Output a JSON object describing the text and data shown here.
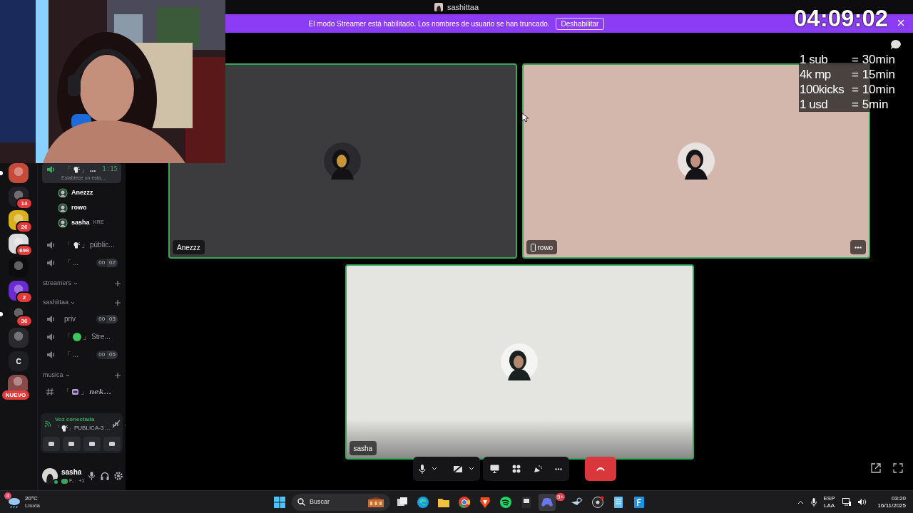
{
  "title_bar": {
    "title": "sashittaa"
  },
  "banner": {
    "text": "El modo Streamer está habilitado. Los nombres de usuario se han truncado.",
    "button": "Deshabilitar"
  },
  "timer": "04:09:02",
  "overlay_rates": [
    {
      "item": "1 sub",
      "value": "= 30min"
    },
    {
      "item": "4k mp",
      "value": "= 15min"
    },
    {
      "item": "100kicks",
      "value": "= 10min"
    },
    {
      "item": "1 usd",
      "value": "= 5min"
    }
  ],
  "servers": [
    {
      "kind": "picture",
      "color": "#c44a3a",
      "unread": true
    },
    {
      "kind": "picture",
      "color": "#222226",
      "badge": "14",
      "unread": false
    },
    {
      "kind": "picture",
      "color": "#d8b020",
      "badge": "26",
      "unread": false
    },
    {
      "kind": "picture",
      "color": "#dcdcdc",
      "badge": "696",
      "unread": false
    },
    {
      "kind": "picture",
      "color": "#0c0c0e",
      "unread": false
    },
    {
      "kind": "picture",
      "color": "#6a2bd0",
      "badge": "2",
      "unread": false
    },
    {
      "kind": "picture",
      "color": "#141414",
      "badge": "36",
      "unread": true
    },
    {
      "kind": "picture",
      "color": "#2a2a2e",
      "unread": false
    },
    {
      "kind": "letter",
      "label": "C",
      "unread": false
    },
    {
      "kind": "picture",
      "color": "#8a4a4a",
      "tag": "NUEVO",
      "unread": false
    }
  ],
  "channels": [
    {
      "kind": "voice",
      "active": true,
      "open": "「",
      "glyph": {
        "kind": "speaker"
      },
      "close": "」",
      "name": "...",
      "timer": "1:15",
      "status": "Establece un esta...",
      "members": [
        {
          "name": "Anezzz"
        },
        {
          "name": "rowo"
        },
        {
          "name": "sasha",
          "tag": "KRE"
        }
      ]
    },
    {
      "kind": "voice",
      "active": false,
      "open": "「",
      "glyph": {
        "kind": "speaker"
      },
      "close": "」",
      "name": "públic..."
    },
    {
      "kind": "voice",
      "active": false,
      "open": "「",
      "name": "...",
      "count": "00",
      "limit": "02"
    },
    {
      "kind": "category",
      "name": "streamers"
    },
    {
      "kind": "category",
      "name": "sashittaa"
    },
    {
      "kind": "voice",
      "active": false,
      "name": "priv",
      "count": "00",
      "limit": "03"
    },
    {
      "kind": "voice",
      "active": false,
      "open": "「",
      "glyph": {
        "kind": "dot"
      },
      "close": "」",
      "name": "Stre..."
    },
    {
      "kind": "voice",
      "active": false,
      "open": "「",
      "name": "...",
      "count": "00",
      "limit": "05"
    },
    {
      "kind": "category",
      "name": "musica"
    },
    {
      "kind": "text",
      "open": "「",
      "glyph": {
        "kind": "robot"
      },
      "close": "」",
      "name": "nek..."
    }
  ],
  "voice_panel": {
    "status": "Voz conectada",
    "open": "「",
    "close": "」",
    "channel": "PUBLICA-3 ..."
  },
  "user": {
    "name": "sasha",
    "status": "F...",
    "extra": "+1"
  },
  "tiles": [
    {
      "name": "Anezzz",
      "kind": "dark",
      "mobile": false,
      "speaking": true,
      "menu": false
    },
    {
      "name": "rowo",
      "kind": "rose",
      "mobile": true,
      "speaking": true,
      "menu": true
    },
    {
      "name": "sasha",
      "kind": "light",
      "mobile": false,
      "speaking": true,
      "menu": false
    }
  ],
  "taskbar": {
    "temperature": "20°C",
    "weather": "Lluvia",
    "weather_badge": "4",
    "search": "Buscar",
    "chat_badge": "9+",
    "language": "ESP",
    "layout": "LAA",
    "time": "03:20",
    "date": "16/11/2025"
  }
}
